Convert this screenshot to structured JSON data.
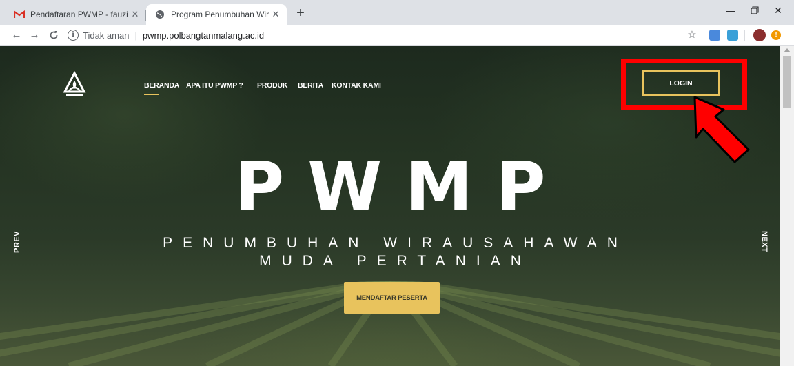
{
  "browser": {
    "tabs": [
      {
        "title": "Pendaftaran PWMP - fauziah.yuq",
        "icon": "gmail-icon",
        "active": false
      },
      {
        "title": "Program Penumbuhan Wirausaha",
        "icon": "globe-icon",
        "active": true
      }
    ],
    "new_tab_label": "+",
    "address": {
      "security_label": "Tidak aman",
      "separator": "|",
      "url": "pwmp.polbangtanmalang.ac.id"
    }
  },
  "site": {
    "nav": [
      "BERANDA",
      "APA ITU PWMP ?",
      "PRODUK",
      "BERITA",
      "KONTAK KAMI"
    ],
    "login_label": "LOGIN",
    "hero_title": "PWMP",
    "hero_subtitle_line1": "PENUMBUHAN WIRAUSAHAWAN",
    "hero_subtitle_line2": "MUDA PERTANIAN",
    "cta_label": "MENDAFTAR PESERTA",
    "prev_label": "PREV",
    "next_label": "NEXT"
  },
  "colors": {
    "accent_gold": "#e8c35d",
    "annotation_red": "#ff0000"
  }
}
